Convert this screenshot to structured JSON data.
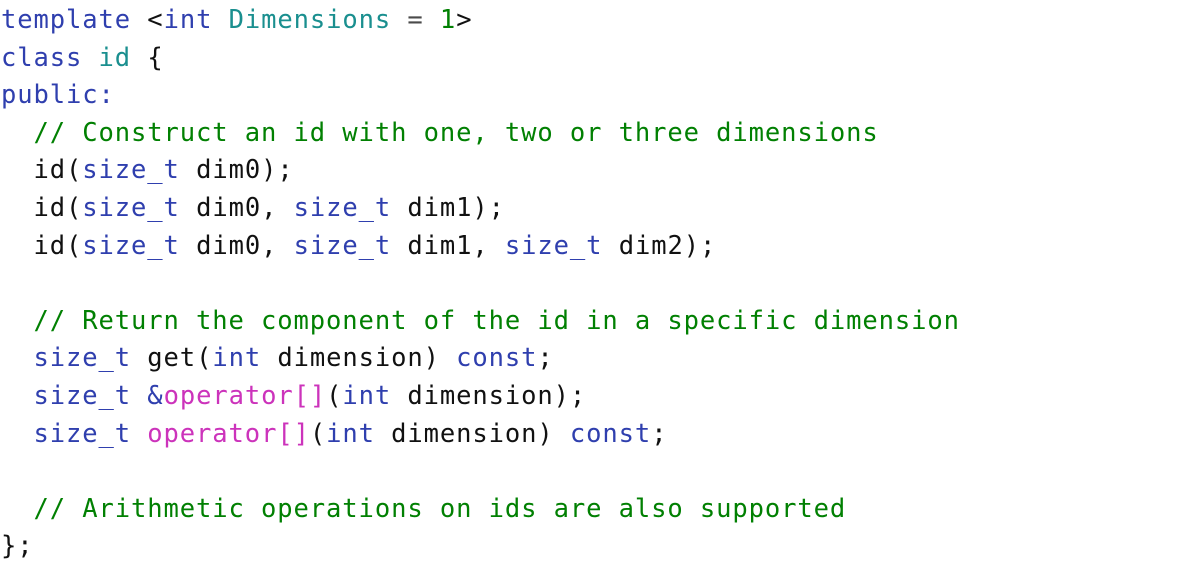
{
  "document": {
    "kind": "code-listing",
    "language": "C++",
    "background_color": "#ffffff",
    "line_count": 14
  },
  "palette": {
    "keyword": "#2f3fae",
    "type": "#1a8f8f",
    "comment": "#018002",
    "function": "#8a7306",
    "operator": "#cc33bb",
    "parameter": "#2c2c93",
    "punctuation": "#111111",
    "number": "#018002",
    "equals": "#4a4a4a"
  },
  "code": {
    "lines": [
      {
        "index": 1,
        "text": "template <int Dimensions = 1>",
        "tokens": [
          {
            "t": "template",
            "c": "keyword"
          },
          {
            "t": " ",
            "c": "plain"
          },
          {
            "t": "<",
            "c": "punct"
          },
          {
            "t": "int",
            "c": "keyword"
          },
          {
            "t": " ",
            "c": "plain"
          },
          {
            "t": "Dimensions",
            "c": "type"
          },
          {
            "t": " ",
            "c": "plain"
          },
          {
            "t": "=",
            "c": "equals"
          },
          {
            "t": " ",
            "c": "plain"
          },
          {
            "t": "1",
            "c": "number"
          },
          {
            "t": ">",
            "c": "punct"
          }
        ]
      },
      {
        "index": 2,
        "text": "class id {",
        "tokens": [
          {
            "t": "class",
            "c": "keyword"
          },
          {
            "t": " ",
            "c": "plain"
          },
          {
            "t": "id",
            "c": "type"
          },
          {
            "t": " ",
            "c": "plain"
          },
          {
            "t": "{",
            "c": "punct"
          }
        ]
      },
      {
        "index": 3,
        "text": "public:",
        "tokens": [
          {
            "t": "public:",
            "c": "keyword"
          }
        ]
      },
      {
        "index": 4,
        "text": "  // Construct an id with one, two or three dimensions",
        "tokens": [
          {
            "t": "  ",
            "c": "plain"
          },
          {
            "t": "// Construct an id with one, two or three dimensions",
            "c": "comment"
          }
        ]
      },
      {
        "index": 5,
        "text": "  id(size_t dim0);",
        "tokens": [
          {
            "t": "  ",
            "c": "plain"
          },
          {
            "t": "id",
            "c": "function"
          },
          {
            "t": "(",
            "c": "punct"
          },
          {
            "t": "size_t",
            "c": "keyword"
          },
          {
            "t": " ",
            "c": "plain"
          },
          {
            "t": "dim0",
            "c": "parameter"
          },
          {
            "t": ");",
            "c": "punct"
          }
        ]
      },
      {
        "index": 6,
        "text": "  id(size_t dim0, size_t dim1);",
        "tokens": [
          {
            "t": "  ",
            "c": "plain"
          },
          {
            "t": "id",
            "c": "function"
          },
          {
            "t": "(",
            "c": "punct"
          },
          {
            "t": "size_t",
            "c": "keyword"
          },
          {
            "t": " ",
            "c": "plain"
          },
          {
            "t": "dim0",
            "c": "parameter"
          },
          {
            "t": ", ",
            "c": "punct"
          },
          {
            "t": "size_t",
            "c": "keyword"
          },
          {
            "t": " ",
            "c": "plain"
          },
          {
            "t": "dim1",
            "c": "parameter"
          },
          {
            "t": ");",
            "c": "punct"
          }
        ]
      },
      {
        "index": 7,
        "text": "  id(size_t dim0, size_t dim1, size_t dim2);",
        "tokens": [
          {
            "t": "  ",
            "c": "plain"
          },
          {
            "t": "id",
            "c": "function"
          },
          {
            "t": "(",
            "c": "punct"
          },
          {
            "t": "size_t",
            "c": "keyword"
          },
          {
            "t": " ",
            "c": "plain"
          },
          {
            "t": "dim0",
            "c": "parameter"
          },
          {
            "t": ", ",
            "c": "punct"
          },
          {
            "t": "size_t",
            "c": "keyword"
          },
          {
            "t": " ",
            "c": "plain"
          },
          {
            "t": "dim1",
            "c": "parameter"
          },
          {
            "t": ", ",
            "c": "punct"
          },
          {
            "t": "size_t",
            "c": "keyword"
          },
          {
            "t": " ",
            "c": "plain"
          },
          {
            "t": "dim2",
            "c": "parameter"
          },
          {
            "t": ");",
            "c": "punct"
          }
        ]
      },
      {
        "index": 8,
        "text": "",
        "tokens": []
      },
      {
        "index": 9,
        "text": "  // Return the component of the id in a specific dimension",
        "tokens": [
          {
            "t": "  ",
            "c": "plain"
          },
          {
            "t": "// Return the component of the id in a specific dimension",
            "c": "comment"
          }
        ]
      },
      {
        "index": 10,
        "text": "  size_t get(int dimension) const;",
        "tokens": [
          {
            "t": "  ",
            "c": "plain"
          },
          {
            "t": "size_t",
            "c": "keyword"
          },
          {
            "t": " ",
            "c": "plain"
          },
          {
            "t": "get",
            "c": "function"
          },
          {
            "t": "(",
            "c": "punct"
          },
          {
            "t": "int",
            "c": "keyword"
          },
          {
            "t": " ",
            "c": "plain"
          },
          {
            "t": "dimension",
            "c": "parameter"
          },
          {
            "t": ") ",
            "c": "punct"
          },
          {
            "t": "const",
            "c": "keyword"
          },
          {
            "t": ";",
            "c": "punct"
          }
        ]
      },
      {
        "index": 11,
        "text": "  size_t &operator[](int dimension);",
        "tokens": [
          {
            "t": "  ",
            "c": "plain"
          },
          {
            "t": "size_t",
            "c": "keyword"
          },
          {
            "t": " ",
            "c": "plain"
          },
          {
            "t": "&",
            "c": "keyword"
          },
          {
            "t": "operator[]",
            "c": "operator"
          },
          {
            "t": "(",
            "c": "punct"
          },
          {
            "t": "int",
            "c": "keyword"
          },
          {
            "t": " ",
            "c": "plain"
          },
          {
            "t": "dimension",
            "c": "parameter"
          },
          {
            "t": ");",
            "c": "punct"
          }
        ]
      },
      {
        "index": 12,
        "text": "  size_t operator[](int dimension) const;",
        "tokens": [
          {
            "t": "  ",
            "c": "plain"
          },
          {
            "t": "size_t",
            "c": "keyword"
          },
          {
            "t": " ",
            "c": "plain"
          },
          {
            "t": "operator[]",
            "c": "operator"
          },
          {
            "t": "(",
            "c": "punct"
          },
          {
            "t": "int",
            "c": "keyword"
          },
          {
            "t": " ",
            "c": "plain"
          },
          {
            "t": "dimension",
            "c": "parameter"
          },
          {
            "t": ") ",
            "c": "punct"
          },
          {
            "t": "const",
            "c": "keyword"
          },
          {
            "t": ";",
            "c": "punct"
          }
        ]
      },
      {
        "index": 13,
        "text": "",
        "tokens": []
      },
      {
        "index": 14,
        "text": "  // Arithmetic operations on ids are also supported",
        "tokens": [
          {
            "t": "  ",
            "c": "plain"
          },
          {
            "t": "// Arithmetic operations on ids are also supported",
            "c": "comment"
          }
        ]
      },
      {
        "index": 15,
        "text": "};",
        "tokens": [
          {
            "t": "};",
            "c": "punct"
          }
        ]
      }
    ]
  }
}
